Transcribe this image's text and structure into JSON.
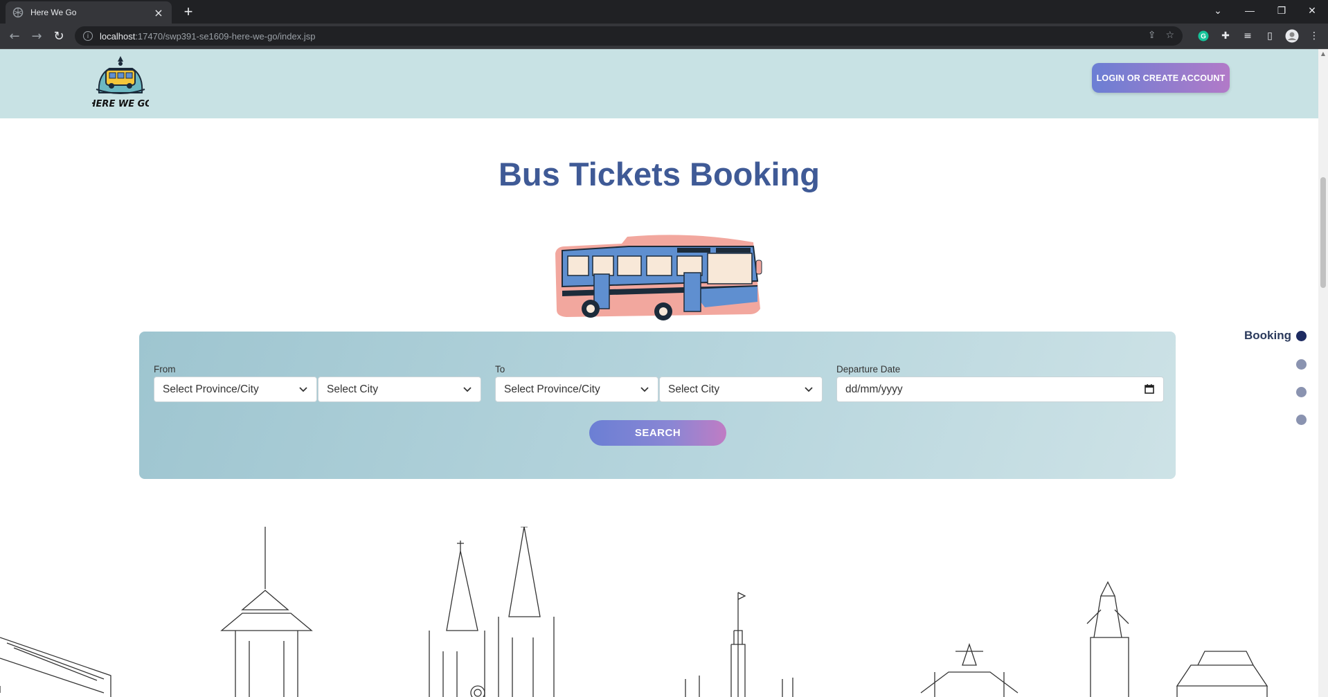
{
  "browser": {
    "tab_title": "Here We Go",
    "new_tab_label": "+",
    "url_host": "localhost",
    "url_path": ":17470/swp391-se1609-here-we-go/index.jsp",
    "window_controls": [
      "chevron-down",
      "minimize",
      "restore",
      "close"
    ]
  },
  "header": {
    "logo_text": "HERE WE GO",
    "login_label": "LOGIN OR CREATE ACCOUNT"
  },
  "main": {
    "title": "Bus Tickets Booking"
  },
  "form": {
    "from_label": "From",
    "to_label": "To",
    "date_label": "Departure Date",
    "from_province": "Select Province/City",
    "from_city": "Select City",
    "to_province": "Select Province/City",
    "to_city": "Select City",
    "date_value": "dd/mm/yyyy",
    "search_label": "SEARCH"
  },
  "side_nav": {
    "items": [
      {
        "label": "Booking",
        "active": true
      },
      {
        "label": "",
        "active": false
      },
      {
        "label": "",
        "active": false
      },
      {
        "label": "",
        "active": false
      }
    ]
  },
  "colors": {
    "header_bg": "#c8e2e4",
    "title": "#3f5a96",
    "accent_start": "#6b7fd4",
    "accent_end": "#b27ac8",
    "panel": "#a9cdd6",
    "nav_active": "#1d2b61"
  }
}
